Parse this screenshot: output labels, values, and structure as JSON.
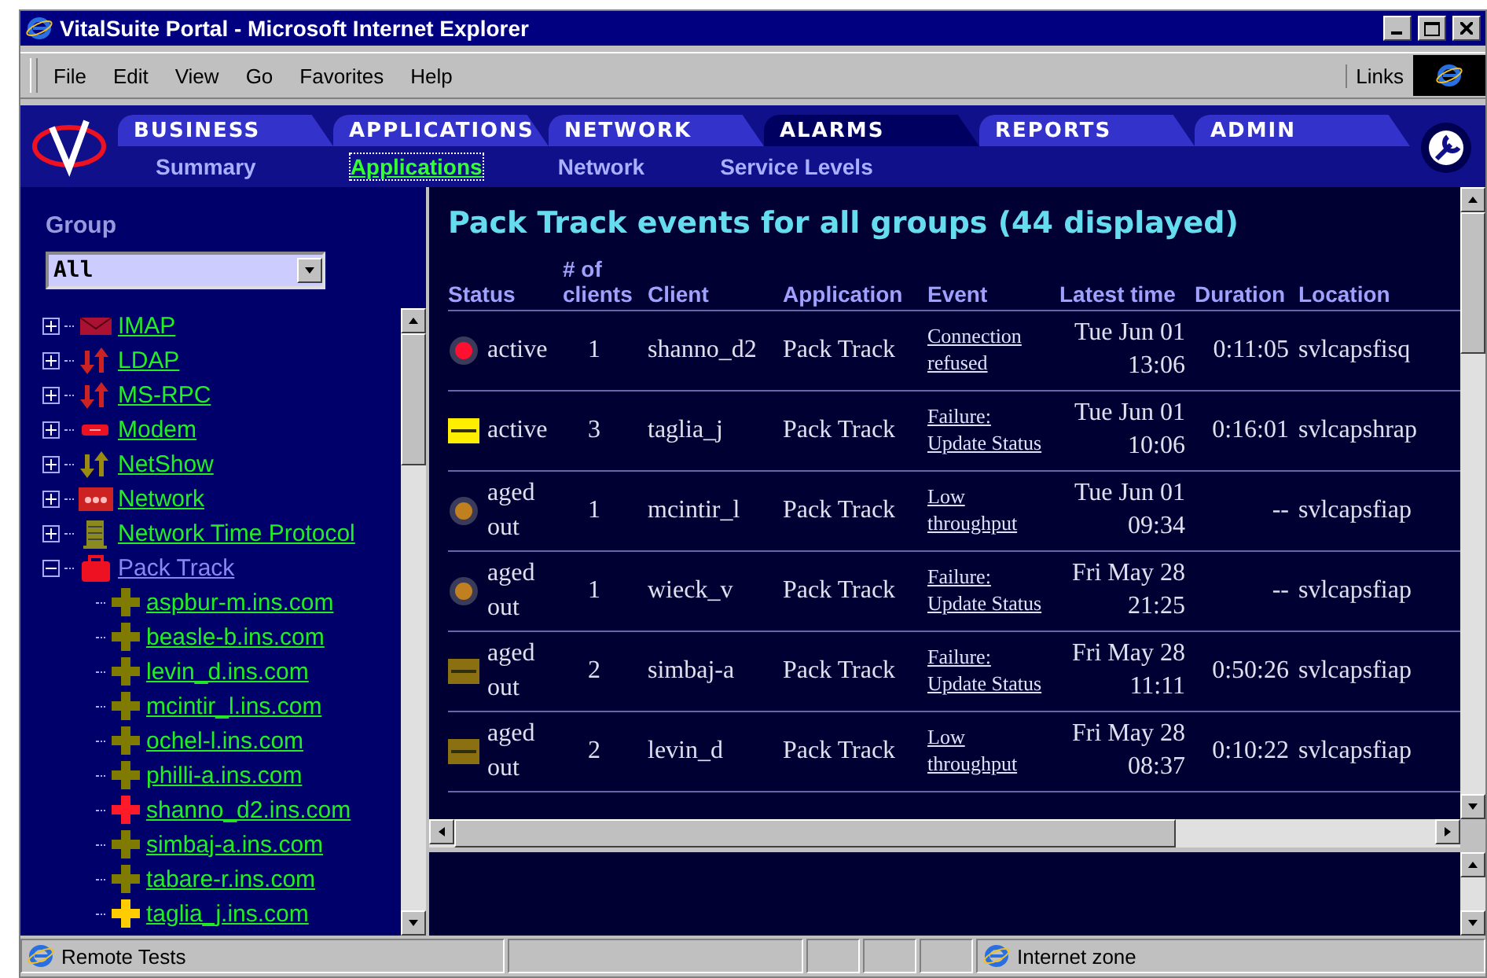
{
  "window": {
    "title": "VitalSuite Portal - Microsoft Internet Explorer"
  },
  "menu": [
    "File",
    "Edit",
    "View",
    "Go",
    "Favorites",
    "Help"
  ],
  "links_label": "Links",
  "tabs": [
    {
      "label": "BUSINESS",
      "selected": false
    },
    {
      "label": "APPLICATIONS",
      "selected": false
    },
    {
      "label": "NETWORK",
      "selected": false
    },
    {
      "label": "ALARMS",
      "selected": true
    },
    {
      "label": "REPORTS",
      "selected": false
    },
    {
      "label": "ADMIN",
      "selected": false
    }
  ],
  "subtabs": [
    {
      "label": "Summary",
      "selected": false
    },
    {
      "label": "Applications",
      "selected": true
    },
    {
      "label": "Network",
      "selected": false
    },
    {
      "label": "Service Levels",
      "selected": false
    }
  ],
  "sidebar": {
    "group_label": "Group",
    "group_value": "All",
    "tree": [
      {
        "label": "IMAP",
        "kind": "mail",
        "expanded": false,
        "selected": false
      },
      {
        "label": "LDAP",
        "kind": "transfer",
        "expanded": false,
        "selected": false
      },
      {
        "label": "MS-RPC",
        "kind": "transfer",
        "expanded": false,
        "selected": false
      },
      {
        "label": "Modem",
        "kind": "modem",
        "expanded": false,
        "selected": false
      },
      {
        "label": "NetShow",
        "kind": "transfer-olive",
        "expanded": false,
        "selected": false
      },
      {
        "label": "Network",
        "kind": "network",
        "expanded": false,
        "selected": false
      },
      {
        "label": "Network Time Protocol",
        "kind": "server",
        "expanded": false,
        "selected": false
      },
      {
        "label": "Pack Track",
        "kind": "package",
        "expanded": true,
        "selected": true,
        "children": [
          {
            "label": "aspbur-m.ins.com",
            "color": "#7f7a00"
          },
          {
            "label": "beasle-b.ins.com",
            "color": "#7f7a00"
          },
          {
            "label": "levin_d.ins.com",
            "color": "#7f7a00"
          },
          {
            "label": "mcintir_l.ins.com",
            "color": "#7f7a00"
          },
          {
            "label": "ochel-l.ins.com",
            "color": "#7f7a00"
          },
          {
            "label": "philli-a.ins.com",
            "color": "#7f7a00"
          },
          {
            "label": "shanno_d2.ins.com",
            "color": "#ff1a2a"
          },
          {
            "label": "simbaj-a.ins.com",
            "color": "#7f7a00"
          },
          {
            "label": "tabare-r.ins.com",
            "color": "#7f7a00"
          },
          {
            "label": "taglia_j.ins.com",
            "color": "#ffcc00"
          }
        ]
      }
    ]
  },
  "main": {
    "title": "Pack Track events for all groups (44 displayed)",
    "columns": [
      [
        "Status"
      ],
      [
        "# of",
        "clients"
      ],
      [
        "Client"
      ],
      [
        "Application"
      ],
      [
        "Event"
      ],
      [
        "Latest time"
      ],
      [
        "Duration"
      ],
      [
        "Location"
      ]
    ],
    "rows": [
      {
        "kind": "dot",
        "color": "#ff1030",
        "status": [
          "active"
        ],
        "clients": "1",
        "client": "shanno_d2",
        "application": "Pack Track",
        "event": [
          "Connection",
          "refused"
        ],
        "time": [
          "Tue Jun 01",
          "13:06"
        ],
        "duration": "0:11:05",
        "location": "svlcapsfisq"
      },
      {
        "kind": "bar",
        "color": "#ffee00",
        "status": [
          "active"
        ],
        "clients": "3",
        "client": "taglia_j",
        "application": "Pack Track",
        "event": [
          "Failure:",
          "Update Status"
        ],
        "time": [
          "Tue Jun 01",
          "10:06"
        ],
        "duration": "0:16:01",
        "location": "svlcapshrap"
      },
      {
        "kind": "dot",
        "color": "#c08020",
        "status": [
          "aged",
          "out"
        ],
        "clients": "1",
        "client": "mcintir_l",
        "application": "Pack Track",
        "event": [
          "Low",
          "throughput"
        ],
        "time": [
          "Tue Jun 01",
          "09:34"
        ],
        "duration": "--",
        "location": "svlcapsfiap"
      },
      {
        "kind": "dot",
        "color": "#c08020",
        "status": [
          "aged",
          "out"
        ],
        "clients": "1",
        "client": "wieck_v",
        "application": "Pack Track",
        "event": [
          "Failure:",
          "Update Status"
        ],
        "time": [
          "Fri May 28",
          "21:25"
        ],
        "duration": "--",
        "location": "svlcapsfiap"
      },
      {
        "kind": "bar",
        "color": "#8a7010",
        "status": [
          "aged",
          "out"
        ],
        "clients": "2",
        "client": "simbaj-a",
        "application": "Pack Track",
        "event": [
          "Failure:",
          "Update Status"
        ],
        "time": [
          "Fri May 28",
          "11:11"
        ],
        "duration": "0:50:26",
        "location": "svlcapsfiap"
      },
      {
        "kind": "bar",
        "color": "#8a7010",
        "status": [
          "aged",
          "out"
        ],
        "clients": "2",
        "client": "levin_d",
        "application": "Pack Track",
        "event": [
          "Low",
          "throughput"
        ],
        "time": [
          "Fri May 28",
          "08:37"
        ],
        "duration": "0:10:22",
        "location": "svlcapsfiap"
      }
    ]
  },
  "status_bar": {
    "left": "Remote Tests",
    "zone": "Internet zone"
  }
}
